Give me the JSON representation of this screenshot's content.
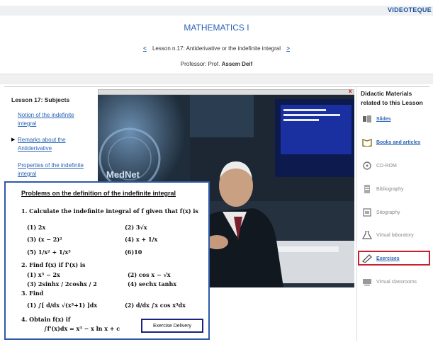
{
  "header": {
    "brand": "VIDEOTEQUE",
    "course_title": "MATHEMATICS I"
  },
  "lesson_nav": {
    "prev": "<",
    "title": "Lesson n.17: Antiderivative or the indefinite integral",
    "next": ">"
  },
  "professor": {
    "label": "Professor: Prof.",
    "name": "Assem Deif"
  },
  "subjects": {
    "title": "Lesson 17: Subjects",
    "items": [
      "Notion of the indefinite integral",
      "Remarks about the Antiderivative",
      "Properties of the indefinite integral"
    ]
  },
  "video": {
    "logo": "MedNet",
    "close": "x"
  },
  "materials": {
    "title": "Didactic Materials related to this Lesson",
    "items": [
      {
        "label": "Slides",
        "active": true
      },
      {
        "label": "Books and articles",
        "active": true
      },
      {
        "label": "CD-ROM",
        "active": false
      },
      {
        "label": "Bibliography",
        "active": false
      },
      {
        "label": "Sitography",
        "active": false
      },
      {
        "label": "Virtual laboratory",
        "active": false
      },
      {
        "label": "Exercises",
        "active": true
      },
      {
        "label": "Virtual classrooms",
        "active": false
      }
    ]
  },
  "popup": {
    "title": "Problems on the definition of the indefinite integral",
    "q1": "1. Calculate the indefinite integral of f given that f(x) is",
    "q1_items": [
      "(1) 2x",
      "(2) 3√x",
      "(3) (x − 2)²",
      "(4) x + 1/x",
      "(5) 1/x² + 1/x³",
      "(6)10"
    ],
    "q2": "2. Find f(x) if f'(x) is",
    "q2_items": [
      "(1) x³ − 2x",
      "(2) cos x − √x",
      "(3) 2sinhx / 2coshx / 2",
      "(4) sechx tanhx"
    ],
    "q3": "3. Find",
    "q3_items": [
      "(1) ∫[ d/dx √(x³+1) ]dx",
      "(2) d/dx ∫x cos x³dx"
    ],
    "q4": "4. Obtain f(x) if",
    "q4_eq": "∫f'(x)dx = x³ − x ln x + c",
    "button": "Exercise Delivery"
  }
}
